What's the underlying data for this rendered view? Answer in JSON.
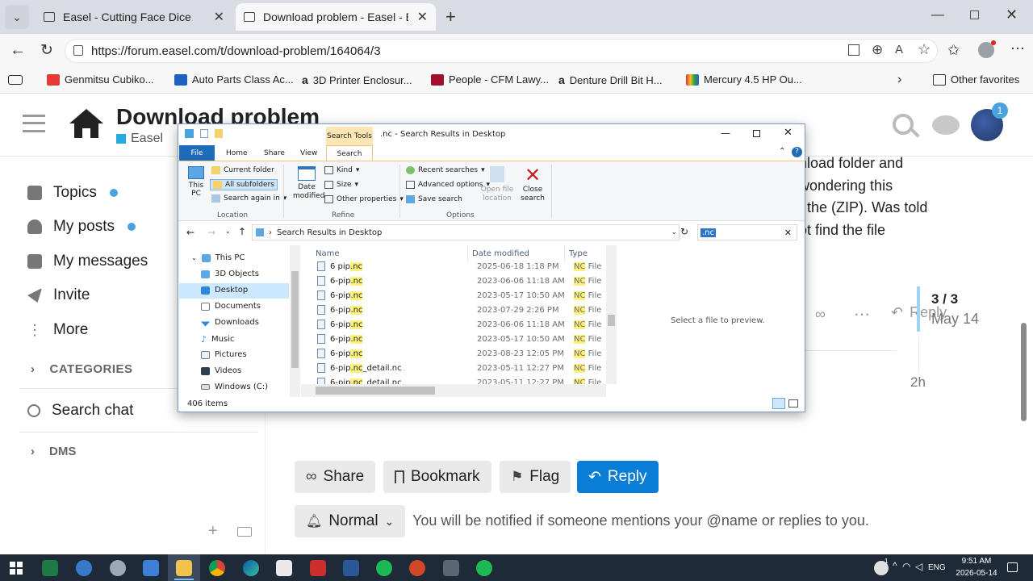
{
  "browser": {
    "tabs": [
      {
        "title": "Easel - Cutting Face Dice"
      },
      {
        "title": "Download problem - Easel - Easel"
      }
    ],
    "url": "https://forum.easel.com/t/download-problem/164064/3",
    "favorites": [
      {
        "label": "Genmitsu Cubiko...",
        "color": "#e53935"
      },
      {
        "label": "Auto Parts Class Ac...",
        "color": "#1e5fbf"
      },
      {
        "label": "3D Printer Enclosur...",
        "color": "#222"
      },
      {
        "label": "People - CFM Lawy...",
        "color": "#a0112f"
      },
      {
        "label": "Denture Drill Bit H...",
        "color": "#222"
      },
      {
        "label": "Mercury 4.5 HP Ou...",
        "color": "#d8323a"
      }
    ],
    "other_favorites": "Other favorites"
  },
  "forum": {
    "title": "Download problem",
    "category": "Easel",
    "notification_count": "1",
    "sidebar": [
      {
        "label": "Topics",
        "dot": true
      },
      {
        "label": "My posts",
        "dot": true
      },
      {
        "label": "My messages",
        "dot": false
      },
      {
        "label": "Invite",
        "dot": false
      },
      {
        "label": "More",
        "dot": false
      }
    ],
    "categories_label": "CATEGORIES",
    "search_chat": "Search chat",
    "dms_label": "DMS",
    "post_lines": [
      "nload folder and",
      "wondering this",
      "f the (ZIP). Was told",
      "ot find the file"
    ],
    "progress": "3 / 3",
    "progress_date": "May 14",
    "reply_label": "Reply",
    "time_ago": "2h",
    "actions": {
      "share": "Share",
      "bookmark": "Bookmark",
      "flag": "Flag",
      "reply": "Reply"
    },
    "notify_level": "Normal",
    "notify_text": "You will be notified if someone mentions your @name or replies to you."
  },
  "explorer": {
    "title": ".nc - Search Results in Desktop",
    "context_tab": "Search Tools",
    "ribbon_tabs": [
      "File",
      "Home",
      "Share",
      "View",
      "Search"
    ],
    "ribbon": {
      "this_pc": "This PC",
      "current_folder": "Current folder",
      "all_subfolders": "All subfolders",
      "search_again_in": "Search again in",
      "location_group": "Location",
      "date_modified": "Date modified",
      "kind": "Kind",
      "size": "Size",
      "other_properties": "Other properties",
      "refine_group": "Refine",
      "recent_searches": "Recent searches",
      "advanced_options": "Advanced options",
      "save_search": "Save search",
      "open_file_location": "Open file location",
      "close_search": "Close search",
      "options_group": "Options"
    },
    "address": "Search Results in Desktop",
    "search_query": ".nc",
    "nav": [
      "This PC",
      "3D Objects",
      "Desktop",
      "Documents",
      "Downloads",
      "Music",
      "Pictures",
      "Videos",
      "Windows (C:)"
    ],
    "columns": {
      "name": "Name",
      "date": "Date modified",
      "type": "Type"
    },
    "files": [
      {
        "base": "6 pip",
        "ext": ".nc",
        "suffix": "",
        "date": "2025-06-18 1:18 PM",
        "type_hl": "NC",
        "type_rest": " File"
      },
      {
        "base": "6-pip",
        "ext": ".nc",
        "suffix": "",
        "date": "2023-06-06 11:18 AM",
        "type_hl": "NC",
        "type_rest": " File"
      },
      {
        "base": "6-pip",
        "ext": ".nc",
        "suffix": "",
        "date": "2023-05-17 10:50 AM",
        "type_hl": "NC",
        "type_rest": " File"
      },
      {
        "base": "6-pip",
        "ext": ".nc",
        "suffix": "",
        "date": "2023-07-29 2:26 PM",
        "type_hl": "NC",
        "type_rest": " File"
      },
      {
        "base": "6-pip",
        "ext": ".nc",
        "suffix": "",
        "date": "2023-06-06 11:18 AM",
        "type_hl": "NC",
        "type_rest": " File"
      },
      {
        "base": "6-pip",
        "ext": ".nc",
        "suffix": "",
        "date": "2023-05-17 10:50 AM",
        "type_hl": "NC",
        "type_rest": " File"
      },
      {
        "base": "6-pip",
        "ext": ".nc",
        "suffix": "",
        "date": "2023-08-23 12:05 PM",
        "type_hl": "NC",
        "type_rest": " File"
      },
      {
        "base": "6-pip",
        "ext": ".nc",
        "suffix": "_detail.nc",
        "date": "2023-05-11 12:27 PM",
        "type_hl": "NC",
        "type_rest": " File"
      },
      {
        "base": "6-pip",
        "ext": ".nc",
        "suffix": "_detail.nc",
        "date": "2023-05-11 12:27 PM",
        "type_hl": "NC",
        "type_rest": " File"
      }
    ],
    "preview_text": "Select a file to preview.",
    "status": "406 items"
  },
  "taskbar": {
    "lang": "ENG",
    "time": "9:51 AM",
    "date": "2026-05-14",
    "badge": "1"
  }
}
